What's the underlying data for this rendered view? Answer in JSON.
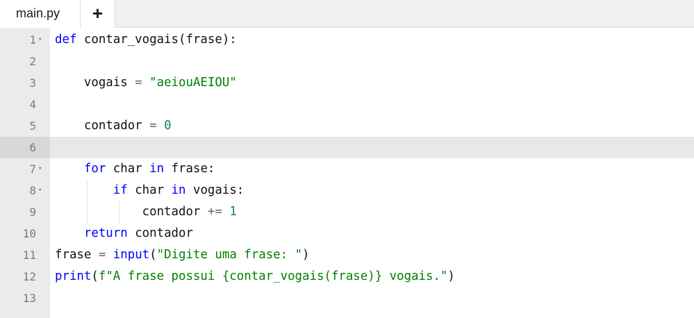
{
  "tabs": {
    "file_label": "main.py",
    "add_label": "+"
  },
  "editor": {
    "fold_glyph": "▾",
    "active_line": 6,
    "lines": [
      {
        "n": "1",
        "fold": true,
        "tokens": [
          [
            "def",
            "t-kw"
          ],
          [
            " contar_vogais(frase):",
            ""
          ]
        ]
      },
      {
        "n": "2",
        "fold": false,
        "tokens": []
      },
      {
        "n": "3",
        "fold": false,
        "tokens": [
          [
            "    vogais ",
            ""
          ],
          [
            "=",
            "t-op"
          ],
          [
            " ",
            ""
          ],
          [
            "\"aeiouAEIOU\"",
            "t-str-g"
          ]
        ]
      },
      {
        "n": "4",
        "fold": false,
        "tokens": []
      },
      {
        "n": "5",
        "fold": false,
        "tokens": [
          [
            "    contador ",
            ""
          ],
          [
            "=",
            "t-op"
          ],
          [
            " ",
            ""
          ],
          [
            "0",
            "t-num"
          ]
        ]
      },
      {
        "n": "6",
        "fold": false,
        "tokens": []
      },
      {
        "n": "7",
        "fold": true,
        "tokens": [
          [
            "    ",
            ""
          ],
          [
            "for",
            "t-kw"
          ],
          [
            " char ",
            ""
          ],
          [
            "in",
            "t-kw"
          ],
          [
            " frase:",
            ""
          ]
        ]
      },
      {
        "n": "8",
        "fold": true,
        "tokens": [
          [
            "        ",
            ""
          ],
          [
            "if",
            "t-kw"
          ],
          [
            " char ",
            ""
          ],
          [
            "in",
            "t-kw"
          ],
          [
            " vogais:",
            ""
          ]
        ]
      },
      {
        "n": "9",
        "fold": false,
        "tokens": [
          [
            "            contador ",
            ""
          ],
          [
            "+=",
            "t-op"
          ],
          [
            " ",
            ""
          ],
          [
            "1",
            "t-num"
          ]
        ]
      },
      {
        "n": "10",
        "fold": false,
        "tokens": [
          [
            "    ",
            ""
          ],
          [
            "return",
            "t-kw"
          ],
          [
            " contador",
            ""
          ]
        ]
      },
      {
        "n": "11",
        "fold": false,
        "tokens": [
          [
            "frase ",
            ""
          ],
          [
            "=",
            "t-op"
          ],
          [
            " ",
            ""
          ],
          [
            "input",
            "t-fn"
          ],
          [
            "(",
            ""
          ],
          [
            "\"Digite uma frase: \"",
            "t-str-g"
          ],
          [
            ")",
            ""
          ]
        ]
      },
      {
        "n": "12",
        "fold": false,
        "tokens": [
          [
            "print",
            "t-fn"
          ],
          [
            "(",
            ""
          ],
          [
            "f\"A frase possui {contar_vogais(frase)} vogais.\"",
            "t-str-g"
          ],
          [
            ")",
            ""
          ]
        ]
      },
      {
        "n": "13",
        "fold": false,
        "tokens": []
      }
    ]
  }
}
